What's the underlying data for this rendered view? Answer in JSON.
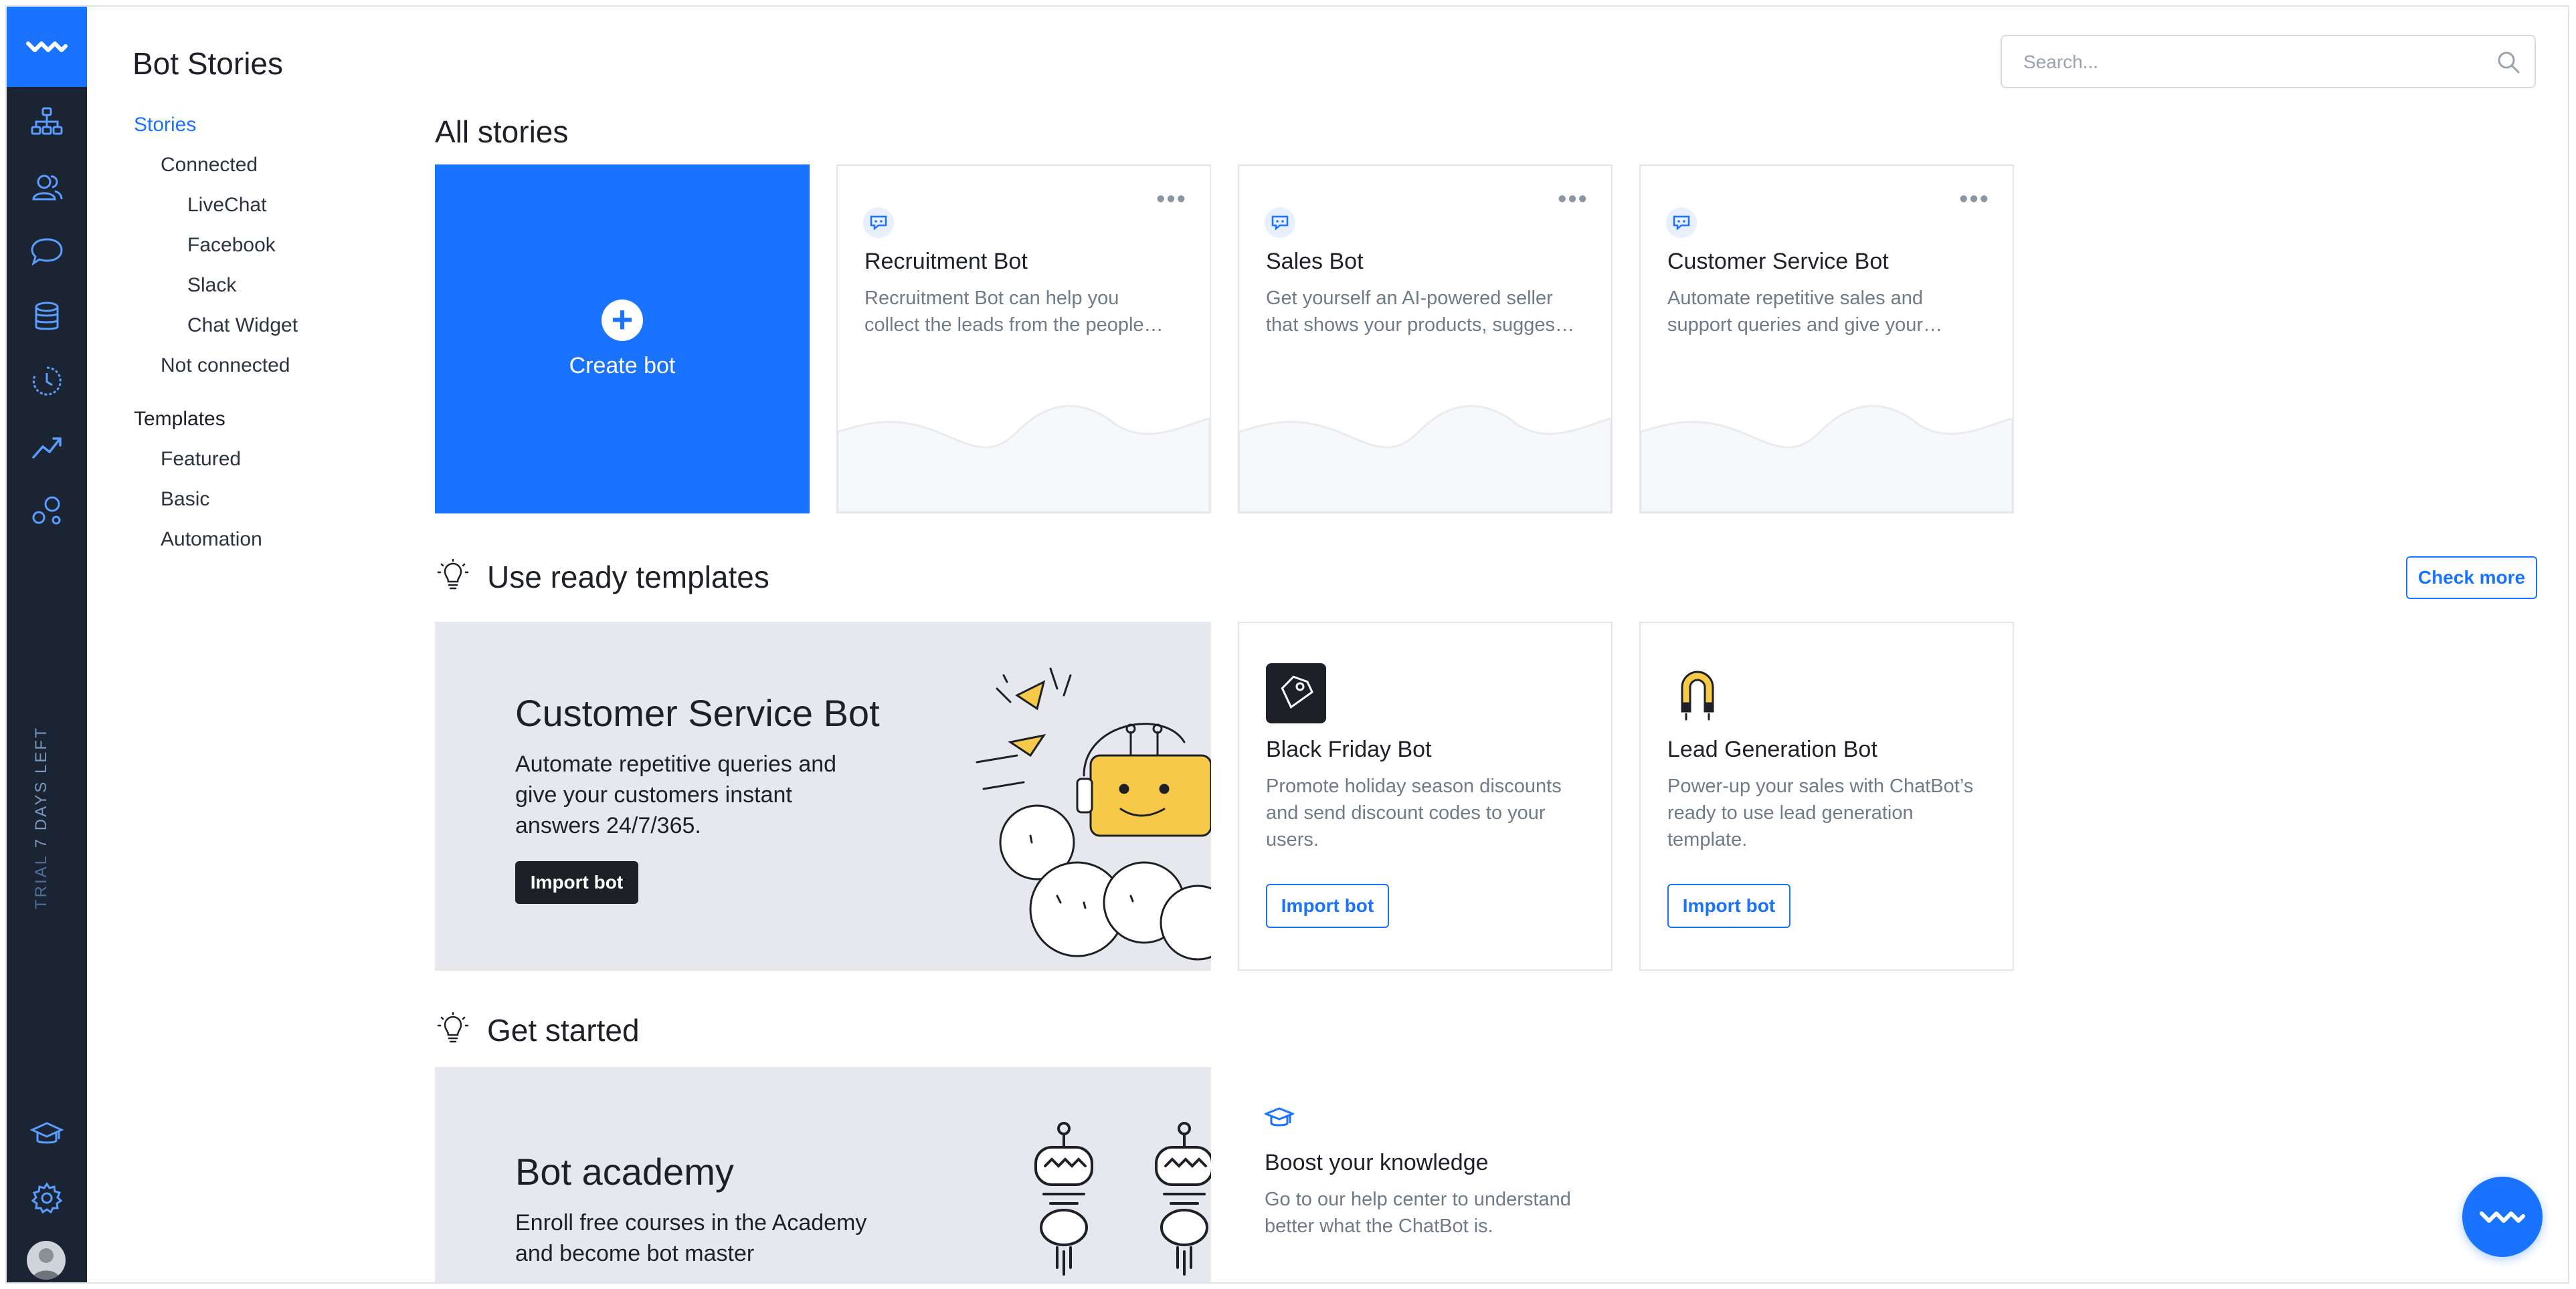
{
  "sidebar": {
    "trial": {
      "word": "TRIAL",
      "days": "7 DAYS LEFT"
    }
  },
  "subnav": {
    "title": "Bot Stories",
    "stories": "Stories",
    "connected": "Connected",
    "connected_items": [
      "LiveChat",
      "Facebook",
      "Slack",
      "Chat Widget"
    ],
    "not_connected": "Not connected",
    "templates": "Templates",
    "template_items": [
      "Featured",
      "Basic",
      "Automation"
    ]
  },
  "search": {
    "placeholder": "Search..."
  },
  "all_stories": {
    "title": "All stories",
    "create_label": "Create bot",
    "bots": [
      {
        "title": "Recruitment Bot",
        "desc1": "Recruitment Bot can help you",
        "desc2": "collect the leads from the people…"
      },
      {
        "title": "Sales Bot",
        "desc1": "Get yourself an AI-powered seller",
        "desc2": "that shows your products, sugges…"
      },
      {
        "title": "Customer Service Bot",
        "desc1": "Automate repetitive sales and",
        "desc2": "support queries and give your…"
      }
    ]
  },
  "templates": {
    "title": "Use ready templates",
    "check_more": "Check more",
    "featured": {
      "title": "Customer Service Bot",
      "desc": [
        "Automate repetitive queries and",
        "give your customers instant",
        "answers 24/7/365."
      ],
      "button": "Import bot"
    },
    "cards": [
      {
        "title": "Black Friday Bot",
        "desc": [
          "Promote holiday season discounts",
          "and send discount codes to your",
          "users."
        ],
        "button": "Import bot"
      },
      {
        "title": "Lead Generation Bot",
        "desc": [
          "Power-up your sales with ChatBot’s",
          "ready to use lead generation",
          "template."
        ],
        "button": "Import bot"
      }
    ]
  },
  "get_started": {
    "title": "Get started",
    "academy": {
      "title": "Bot academy",
      "desc": [
        "Enroll free courses in the Academy",
        "and become bot master"
      ]
    },
    "knowledge": {
      "title": "Boost your knowledge",
      "desc": [
        "Go to our help center to understand",
        "better what the ChatBot is."
      ]
    }
  },
  "colors": {
    "accent": "#1a73ff",
    "rail": "#1b2433",
    "banner": "#e6e8ee"
  }
}
